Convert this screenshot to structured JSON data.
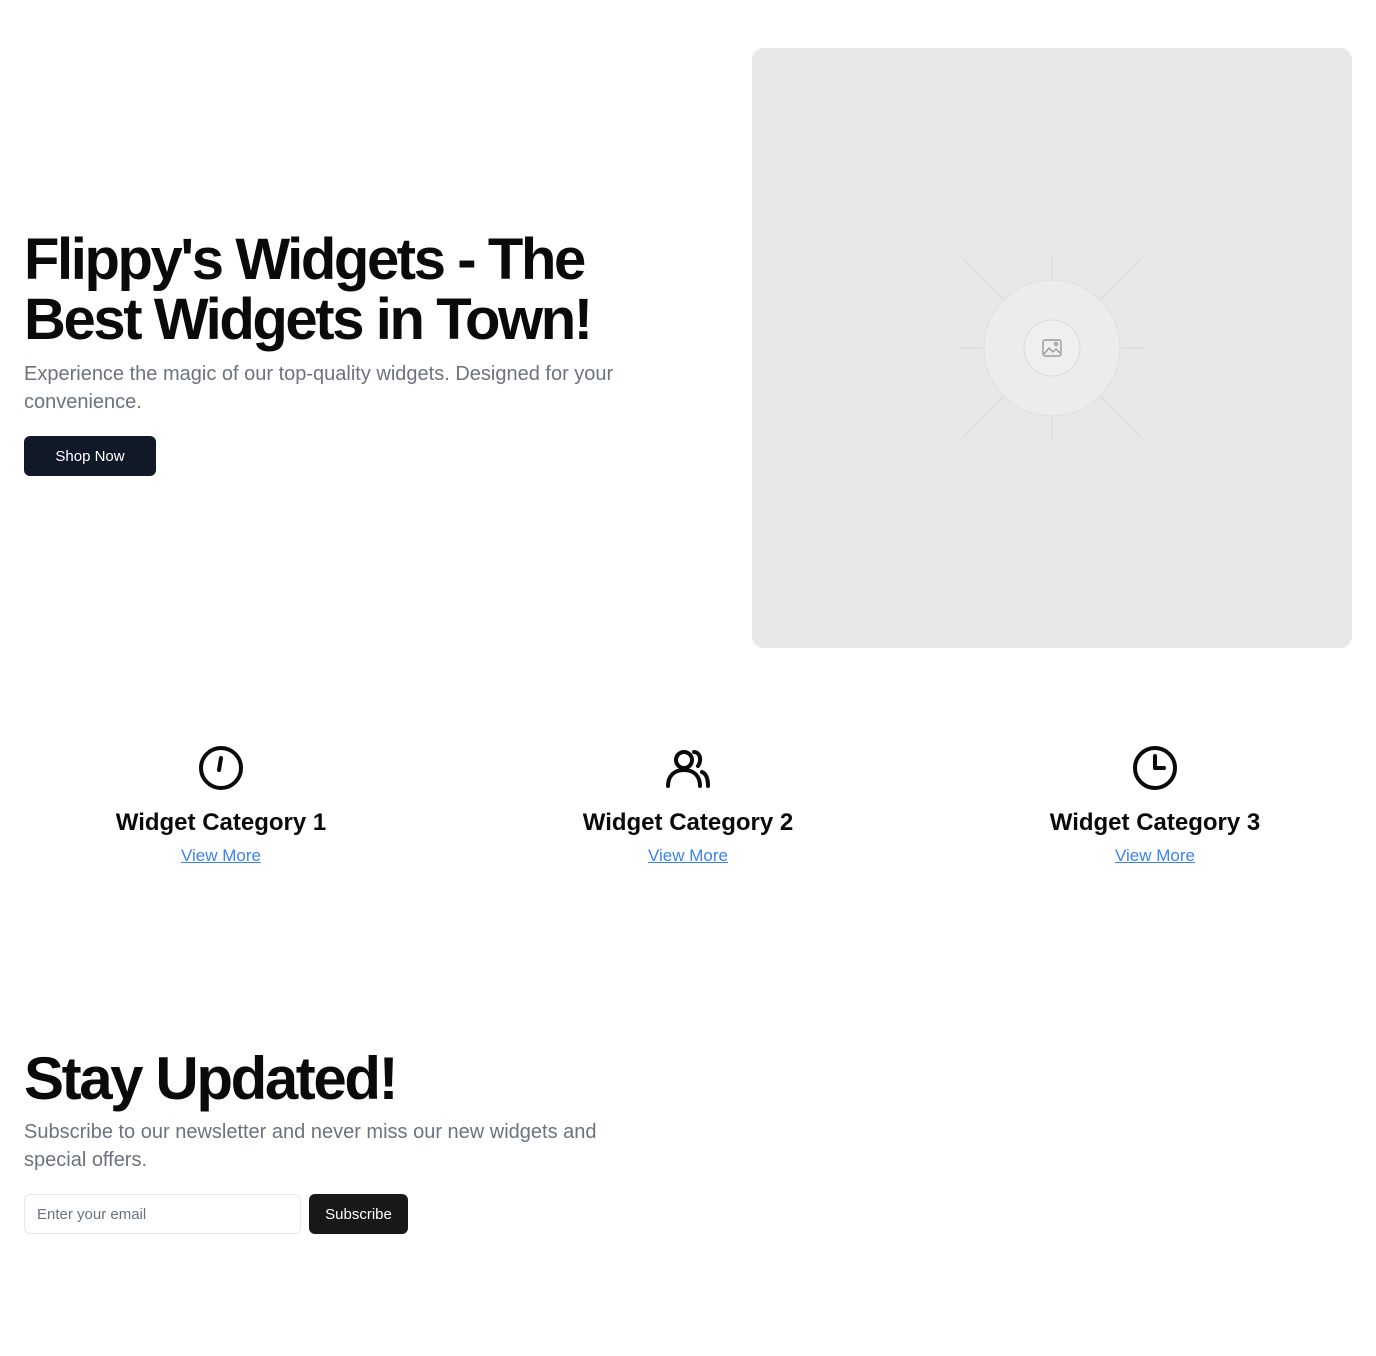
{
  "hero": {
    "title": "Flippy's Widgets - The Best Widgets in Town!",
    "subtitle": "Experience the magic of our top-quality widgets. Designed for your convenience.",
    "cta_label": "Shop Now",
    "image_icon": "image-placeholder-icon"
  },
  "categories": [
    {
      "title": "Widget Category 1",
      "link_label": "View More",
      "icon": "timer-icon"
    },
    {
      "title": "Widget Category 2",
      "link_label": "View More",
      "icon": "users-icon"
    },
    {
      "title": "Widget Category 3",
      "link_label": "View More",
      "icon": "clock-icon"
    }
  ],
  "newsletter": {
    "title": "Stay Updated!",
    "subtitle": "Subscribe to our newsletter and never miss our new widgets and special offers.",
    "email_placeholder": "Enter your email",
    "button_label": "Subscribe"
  },
  "colors": {
    "primary_button": "#111827",
    "subscribe_button": "#18181b",
    "link": "#3b82f6",
    "muted_text": "#6b7280",
    "image_placeholder_bg": "#e8e8e8"
  }
}
